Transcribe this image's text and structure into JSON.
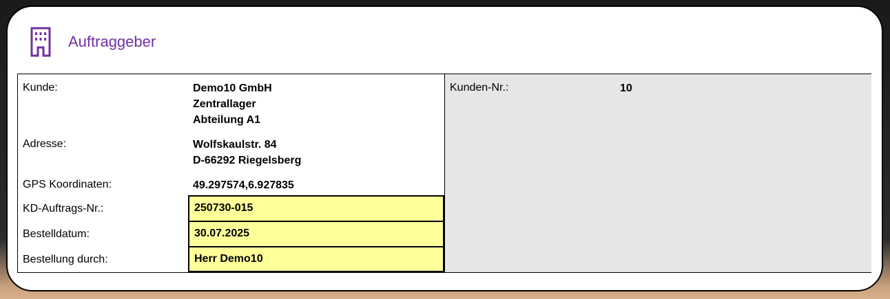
{
  "header": {
    "title": "Auftraggeber",
    "icon": "building-icon",
    "accent": "#7030a0"
  },
  "left": {
    "kunde": {
      "label": "Kunde:",
      "lines": [
        "Demo10 GmbH",
        "Zentrallager",
        "Abteilung A1"
      ]
    },
    "adresse": {
      "label": "Adresse:",
      "lines": [
        "Wolfskaulstr. 84",
        "D-66292 Riegelsberg"
      ]
    },
    "gps": {
      "label": "GPS Koordinaten:",
      "value": "49.297574,6.927835"
    },
    "auftrag": {
      "label": "KD-Auftrags-Nr.:",
      "value": "250730-015"
    },
    "datum": {
      "label": "Bestelldatum:",
      "value": "30.07.2025"
    },
    "durch": {
      "label": "Bestellung durch:",
      "value": "Herr Demo10"
    }
  },
  "right": {
    "kundennr": {
      "label": "Kunden-Nr.:",
      "value": "10"
    }
  }
}
